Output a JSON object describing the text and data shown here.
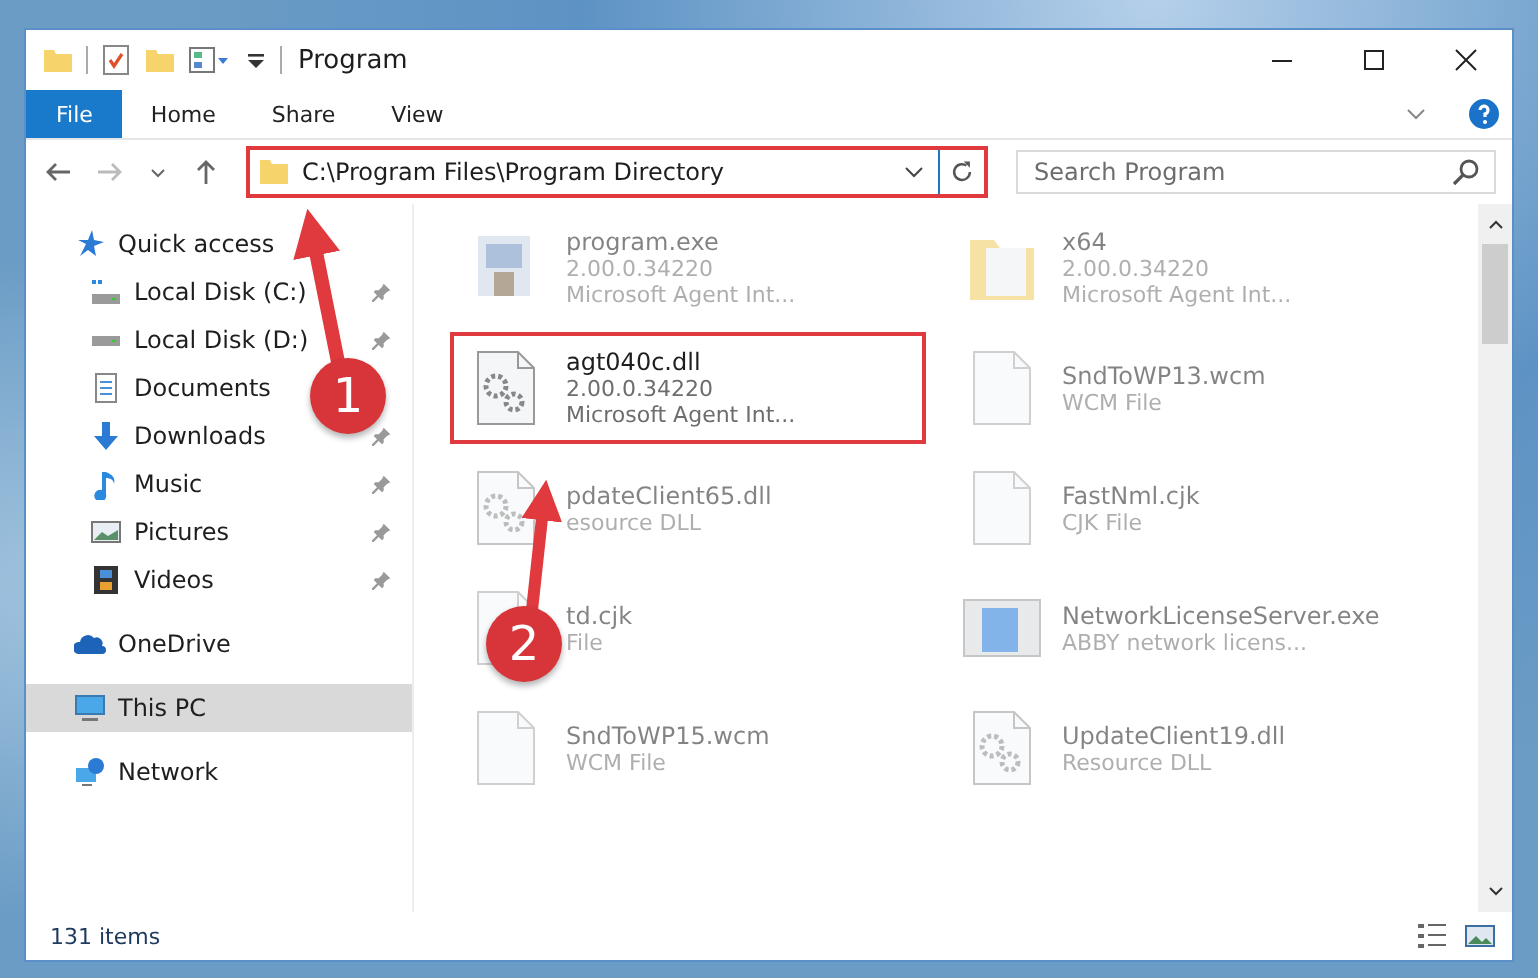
{
  "window": {
    "title": "Program"
  },
  "ribbon_tabs": [
    {
      "label": "File",
      "selected": true
    },
    {
      "label": "Home",
      "selected": false
    },
    {
      "label": "Share",
      "selected": false
    },
    {
      "label": "View",
      "selected": false
    }
  ],
  "address_bar": {
    "path": "C:\\Program Files\\Program Directory",
    "highlighted": true
  },
  "search": {
    "placeholder": "Search Program"
  },
  "sidebar": {
    "items": [
      {
        "label": "Quick access",
        "kind": "star",
        "pinned": false,
        "selected": false,
        "group": true
      },
      {
        "label": "Local Disk (C:)",
        "kind": "drive-c",
        "pinned": true,
        "selected": false,
        "group": false
      },
      {
        "label": "Local Disk (D:)",
        "kind": "drive",
        "pinned": true,
        "selected": false,
        "group": false
      },
      {
        "label": "Documents",
        "kind": "documents",
        "pinned": false,
        "selected": false,
        "group": false
      },
      {
        "label": "Downloads",
        "kind": "downloads",
        "pinned": true,
        "selected": false,
        "group": false
      },
      {
        "label": "Music",
        "kind": "music",
        "pinned": true,
        "selected": false,
        "group": false
      },
      {
        "label": "Pictures",
        "kind": "pictures",
        "pinned": true,
        "selected": false,
        "group": false
      },
      {
        "label": "Videos",
        "kind": "videos",
        "pinned": true,
        "selected": false,
        "group": false
      },
      {
        "label": "OneDrive",
        "kind": "cloud",
        "pinned": false,
        "selected": false,
        "group": true
      },
      {
        "label": "This PC",
        "kind": "pc",
        "pinned": false,
        "selected": true,
        "group": true
      },
      {
        "label": "Network",
        "kind": "network",
        "pinned": false,
        "selected": false,
        "group": true
      }
    ]
  },
  "files": [
    {
      "name": "program.exe",
      "lines": [
        "2.00.0.34220",
        "Microsoft Agent Int..."
      ],
      "kind": "exe",
      "highlighted": false,
      "blurred": true
    },
    {
      "name": "x64",
      "lines": [
        "2.00.0.34220",
        "Microsoft Agent Int..."
      ],
      "kind": "folder",
      "highlighted": false,
      "blurred": true
    },
    {
      "name": "agt040c.dll",
      "lines": [
        "2.00.0.34220",
        "Microsoft Agent Int..."
      ],
      "kind": "dll",
      "highlighted": true,
      "blurred": false
    },
    {
      "name": "SndToWP13.wcm",
      "lines": [
        "WCM File"
      ],
      "kind": "blank",
      "highlighted": false,
      "blurred": true
    },
    {
      "name": "pdateClient65.dll",
      "lines": [
        "esource DLL"
      ],
      "kind": "dll",
      "highlighted": false,
      "blurred": true
    },
    {
      "name": "FastNml.cjk",
      "lines": [
        "CJK File"
      ],
      "kind": "blank",
      "highlighted": false,
      "blurred": true
    },
    {
      "name": "td.cjk",
      "lines": [
        "File"
      ],
      "kind": "blank",
      "highlighted": false,
      "blurred": true
    },
    {
      "name": "NetworkLicenseServer.exe",
      "lines": [
        "ABBY network licens..."
      ],
      "kind": "app",
      "highlighted": false,
      "blurred": true
    },
    {
      "name": "SndToWP15.wcm",
      "lines": [
        "WCM File"
      ],
      "kind": "blank",
      "highlighted": false,
      "blurred": true
    },
    {
      "name": "UpdateClient19.dll",
      "lines": [
        "Resource DLL"
      ],
      "kind": "dll",
      "highlighted": false,
      "blurred": true
    }
  ],
  "status_bar": {
    "count": "131 items"
  },
  "annotations": [
    {
      "number": "1"
    },
    {
      "number": "2"
    }
  ]
}
